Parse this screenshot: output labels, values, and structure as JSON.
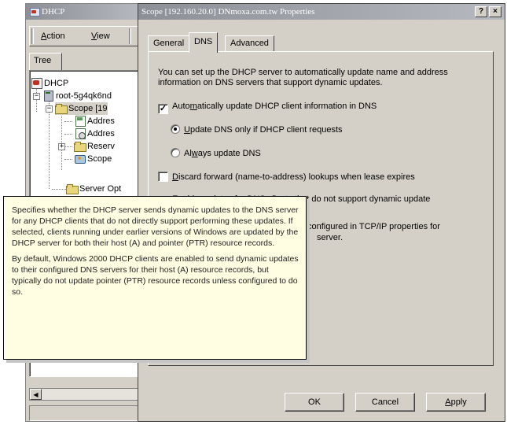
{
  "mmc": {
    "title": "DHCP",
    "menu": {
      "action": "Action",
      "action_key": "A",
      "view": "View",
      "view_key": "V"
    },
    "tree_tab": "Tree",
    "tree": [
      {
        "label": "DHCP",
        "icon": "dhcp-icon"
      },
      {
        "label": "root-5g4qk6nd",
        "icon": "server-icon"
      },
      {
        "label": "Scope [19",
        "icon": "folder-icon"
      },
      {
        "label": "Addres",
        "icon": "address-pool-icon"
      },
      {
        "label": "Addres",
        "icon": "address-leases-icon"
      },
      {
        "label": "Reserv",
        "icon": "reservations-icon"
      },
      {
        "label": "Scope",
        "icon": "scope-options-icon"
      },
      {
        "label": "Server Opt",
        "icon": "server-options-icon"
      }
    ]
  },
  "dialog": {
    "title": "Scope [192.160.20.0] DNmoxa.com.tw Properties",
    "help_button": "?",
    "close_button": "×",
    "tabs": [
      "General",
      "DNS",
      "Advanced"
    ],
    "active_tab": "DNS",
    "intro": "You can set up the DHCP server to automatically update name and address information on DNS servers that support dynamic updates.",
    "options": {
      "auto_update": {
        "pre": "Auto",
        "key": "m",
        "post": "atically update DHCP client information in DNS",
        "checked": true
      },
      "update_on_request": {
        "key": "U",
        "post": "pdate DNS only if DHCP client requests",
        "selected": true
      },
      "always_update": {
        "pre": "Al",
        "key": "w",
        "post": "ays update DNS",
        "selected": false
      },
      "discard_forward": {
        "key": "D",
        "post": "iscard forward (name-to-address) lookups when lease expires",
        "checked": false
      },
      "enable_updates": {
        "pre": "E",
        "post": "nable updates for DNS clients that do not support dynamic update",
        "checked": true
      }
    },
    "partial_text_line1": "configured in TCP/IP properties for",
    "partial_text_line2": "server.",
    "buttons": {
      "ok": "OK",
      "cancel": "Cancel",
      "apply": "Apply",
      "apply_key": "A"
    }
  },
  "tooltip": {
    "paragraph1": "Specifies whether the DHCP server sends dynamic updates to the DNS server for any DHCP clients that do not directly support performing these updates. If selected, clients running under earlier versions of Windows are updated by the DHCP server for both their host (A) and pointer (PTR) resource records.",
    "paragraph2": "By default, Windows 2000 DHCP clients are enabled to send dynamic updates to their configured DNS servers for their host (A) resource records, but typically do not update pointer (PTR) resource records unless configured to do so."
  }
}
